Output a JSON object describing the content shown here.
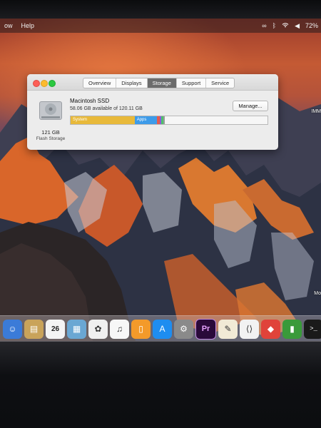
{
  "menubar": {
    "items": [
      "ow",
      "Help"
    ],
    "status": {
      "clock": "72%"
    }
  },
  "window": {
    "tabs": [
      "Overview",
      "Displays",
      "Storage",
      "Support",
      "Service"
    ],
    "active_tab": "Storage",
    "disk": {
      "name": "Macintosh SSD",
      "available": "58.06 GB available of 120.11 GB",
      "size": "121 GB",
      "type": "Flash Storage"
    },
    "manage_label": "Manage...",
    "bar": {
      "system_label": "System",
      "apps_label": "Apps"
    }
  },
  "desktop": {
    "labels": [
      "IMM",
      "Mo"
    ]
  },
  "dock": {
    "apps": [
      {
        "name": "finder-app",
        "glyph": "☺",
        "color": "#3b7bd8"
      },
      {
        "name": "notes-folder-app",
        "glyph": "▤",
        "color": "#c9a35a"
      },
      {
        "name": "calendar-app",
        "glyph": "26",
        "color": "#f4f4f4"
      },
      {
        "name": "photos-preview-app",
        "glyph": "▦",
        "color": "#6aa7d3"
      },
      {
        "name": "photos-app",
        "glyph": "✿",
        "color": "#f0f0f0"
      },
      {
        "name": "itunes-app",
        "glyph": "♫",
        "color": "#f7f7f7"
      },
      {
        "name": "ibooks-app",
        "glyph": "▯",
        "color": "#f39a2a"
      },
      {
        "name": "app-store-app",
        "glyph": "A",
        "color": "#1e8df0"
      },
      {
        "name": "system-preferences-app",
        "glyph": "⚙",
        "color": "#8a8a8a"
      },
      {
        "name": "premiere-pro-app",
        "glyph": "Pr",
        "color": "#2a0a3a"
      },
      {
        "name": "textedit-app",
        "glyph": "✎",
        "color": "#f1ead6"
      },
      {
        "name": "vscode-app",
        "glyph": "⟨⟩",
        "color": "#f2f2f2"
      },
      {
        "name": "anydesk-app",
        "glyph": "◆",
        "color": "#e0433a"
      },
      {
        "name": "activity-app",
        "glyph": "▮",
        "color": "#3a9a3a"
      },
      {
        "name": "terminal-app",
        "glyph": ">_",
        "color": "#1a1a1a"
      },
      {
        "name": "partial-app",
        "glyph": "",
        "color": "#7a7a7a"
      }
    ]
  }
}
